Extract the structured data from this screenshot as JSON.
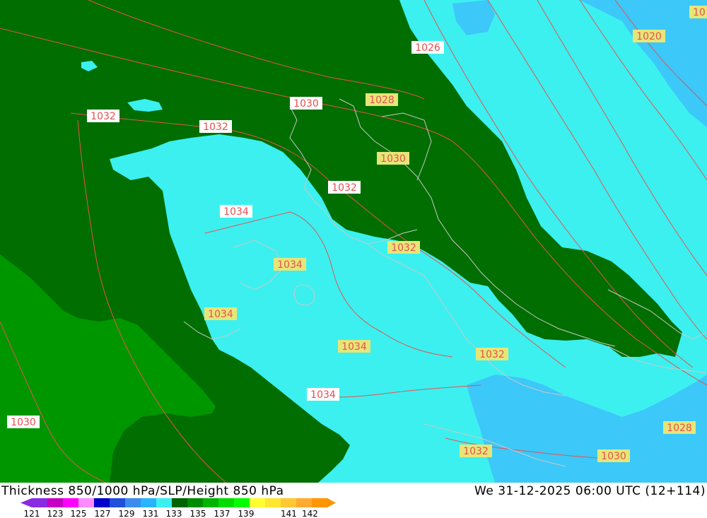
{
  "header": {
    "product": "Thickness 850/1000 hPa/SLP/Height 850 hPa",
    "valid_time": "We 31-12-2025 06:00 UTC (12+114)"
  },
  "legend": {
    "ticks": [
      "121",
      "123",
      "125",
      "127",
      "129",
      "131",
      "133",
      "135",
      "137",
      "139",
      "141",
      "142"
    ],
    "colors": [
      "#8a2be2",
      "#c400c4",
      "#ff00ff",
      "#ff8cff",
      "#0000c8",
      "#1e50dc",
      "#3c8cf0",
      "#28b4ff",
      "#3cf0f0",
      "#006400",
      "#008c00",
      "#00b400",
      "#00dc00",
      "#00ff00",
      "#ffff32",
      "#ffe632",
      "#ffc832",
      "#ffaa32",
      "#ff9600"
    ]
  },
  "map": {
    "colors": {
      "dark_green": "#006e00",
      "mid_green": "#009600",
      "cyan": "#3cf0f0",
      "light_blue": "#3cc8f8",
      "isobar": "#e85050",
      "coast": "#c8c8c8",
      "label_yellow": "#e6e678",
      "label_white": "#ffffff"
    },
    "labels": [
      {
        "text": "1026",
        "style": "white"
      },
      {
        "text": "1020",
        "style": "yellow"
      },
      {
        "text": "10",
        "style": "yellow"
      },
      {
        "text": "1030",
        "style": "white"
      },
      {
        "text": "1028",
        "style": "yellow"
      },
      {
        "text": "1032",
        "style": "white"
      },
      {
        "text": "1032",
        "style": "white"
      },
      {
        "text": "1030",
        "style": "yellow"
      },
      {
        "text": "1032",
        "style": "white"
      },
      {
        "text": "1034",
        "style": "white"
      },
      {
        "text": "1032",
        "style": "yellow"
      },
      {
        "text": "1034",
        "style": "yellow"
      },
      {
        "text": "1034",
        "style": "yellow"
      },
      {
        "text": "1034",
        "style": "yellow"
      },
      {
        "text": "1032",
        "style": "yellow"
      },
      {
        "text": "1034",
        "style": "white"
      },
      {
        "text": "1030",
        "style": "white"
      },
      {
        "text": "1028",
        "style": "yellow"
      },
      {
        "text": "1032",
        "style": "yellow"
      },
      {
        "text": "1030",
        "style": "yellow"
      }
    ]
  }
}
